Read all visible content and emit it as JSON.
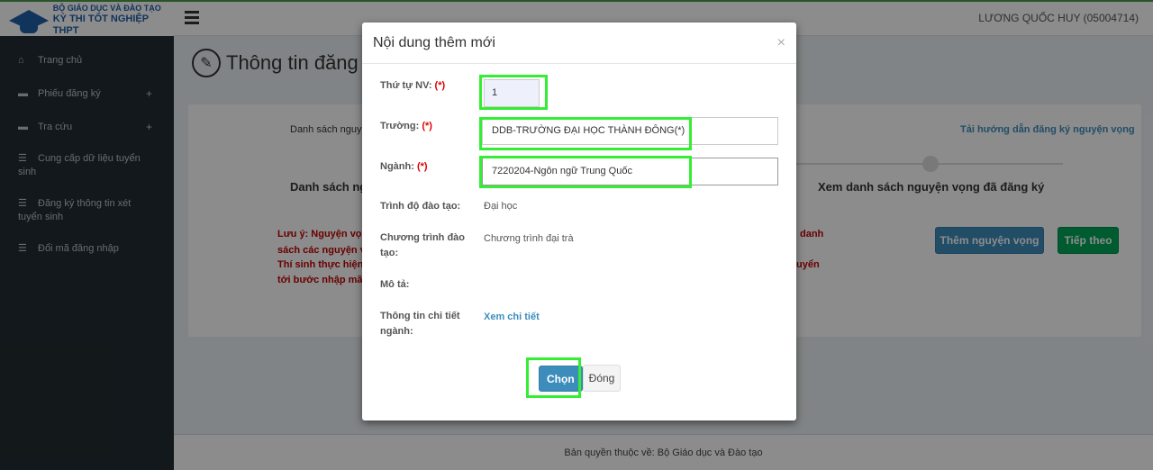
{
  "header": {
    "logo_line1": "BỘ GIÁO DỤC VÀ ĐÀO TẠO",
    "logo_line2": "KỲ THI TỐT NGHIỆP THPT",
    "user": "LƯƠNG QUỐC HUY (05004714)"
  },
  "sidebar": {
    "items": [
      {
        "label": "Trang chủ",
        "icon": "home-icon"
      },
      {
        "label": "Phiếu đăng ký",
        "icon": "folder-icon"
      },
      {
        "label": "Tra cứu",
        "icon": "folder-icon"
      },
      {
        "label": "Cung cấp dữ liệu tuyển sinh",
        "icon": "list-icon"
      },
      {
        "label": "Đăng ký thông tin xét tuyển sinh",
        "icon": "list-icon"
      },
      {
        "label": "Đổi mã đăng nhập",
        "icon": "list-icon"
      }
    ]
  },
  "page": {
    "title": "Thông tin đăng",
    "list_label": "Danh sách nguy",
    "guide_link": "Tải hướng dẫn đăng ký nguyện vọng",
    "section_left": "Danh sách ng",
    "section_right": "Xem danh sách nguyện vọng đã đăng ký",
    "note_line1": "Lưu ý: Nguyện vọn",
    "note_line2": "sách các nguyện v",
    "note_line3": "Thí sinh thực hiện",
    "note_line4": "tới bước nhập mã c",
    "note_right1": "danh",
    "note_right2": "uyển",
    "add_button": "Thêm nguyện vọng",
    "next_button": "Tiếp theo",
    "footer": "Bản quyền thuộc về: Bộ Giáo dục và Đào tạo"
  },
  "modal": {
    "title": "Nội dung thêm mới",
    "close": "×",
    "order_label": "Thứ tự NV: ",
    "school_label": "Trường: ",
    "major_label": "Ngành: ",
    "required_mark": "(*)",
    "order_value": "1",
    "school_value": "DDB-TRƯỜNG ĐẠI HỌC THÀNH ĐÔNG(*)",
    "major_value": "7220204-Ngôn ngữ Trung Quốc",
    "level_label": "Trình độ đào tạo:",
    "level_value": "Đại học",
    "program_label": "Chương trình đào tạo:",
    "program_value": "Chương trình đại trà",
    "desc_label": "Mô tả:",
    "detail_label": "Thông tin chi tiết ngành:",
    "detail_link": "Xem chi tiết",
    "choose_button": "Chọn",
    "close_button": "Đóng"
  },
  "colors": {
    "primary": "#3c8dbc",
    "success": "#00a65a",
    "sidebar": "#222d32",
    "highlight": "#33ee33",
    "required": "#dd0000"
  }
}
